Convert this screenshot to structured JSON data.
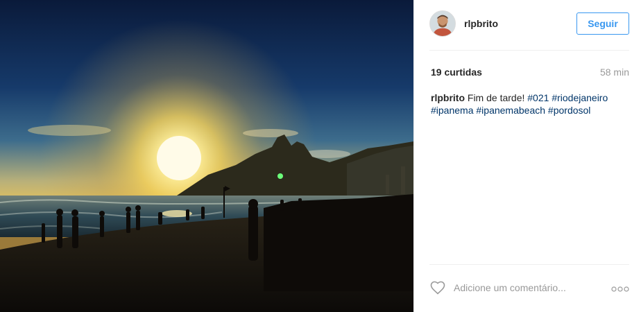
{
  "post": {
    "photo_icon": "beach-sunset-photo",
    "author": {
      "username": "rlpbrito",
      "avatar_icon": "user-avatar"
    },
    "follow_label": "Seguir",
    "likes_text": "19 curtidas",
    "time_ago": "58 min",
    "caption": {
      "username": "rlpbrito",
      "text": "Fim de tarde!",
      "hashtags": [
        "#021",
        "#riodejaneiro",
        "#ipanema",
        "#ipanemabeach",
        "#pordosol"
      ]
    },
    "comment_placeholder": "Adicione um comentário...",
    "icons": {
      "like": "heart-icon",
      "more": "more-options-icon"
    },
    "colors": {
      "accent": "#3897f0",
      "hashtag": "#003569",
      "muted": "#999999"
    }
  }
}
